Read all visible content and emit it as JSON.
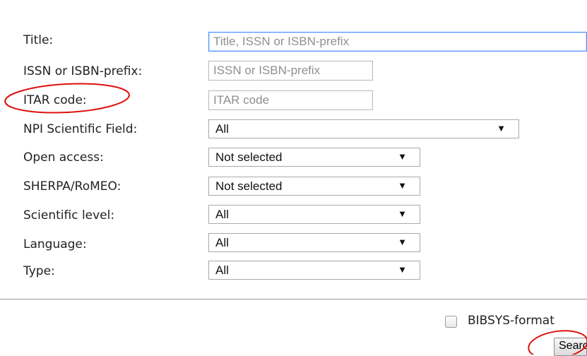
{
  "form": {
    "title": {
      "label": "Title:",
      "placeholder": "Title, ISSN or ISBN-prefix"
    },
    "issn": {
      "label": "ISSN or ISBN-prefix:",
      "placeholder": "ISSN or ISBN-prefix"
    },
    "itar": {
      "label": "ITAR code:",
      "placeholder": "ITAR code"
    },
    "npi": {
      "label": "NPI Scientific Field:",
      "value": "All"
    },
    "open_access": {
      "label": "Open access:",
      "value": "Not selected"
    },
    "sherpa": {
      "label": "SHERPA/RoMEO:",
      "value": "Not selected"
    },
    "level": {
      "label": "Scientific level:",
      "value": "All"
    },
    "language": {
      "label": "Language:",
      "value": "All"
    },
    "type": {
      "label": "Type:",
      "value": "All"
    }
  },
  "options": {
    "bibsys_label": "BIBSYS-format",
    "bibsys_checked": false
  },
  "actions": {
    "search_label": "Search"
  },
  "annotation": {
    "color": "#dd1111"
  }
}
